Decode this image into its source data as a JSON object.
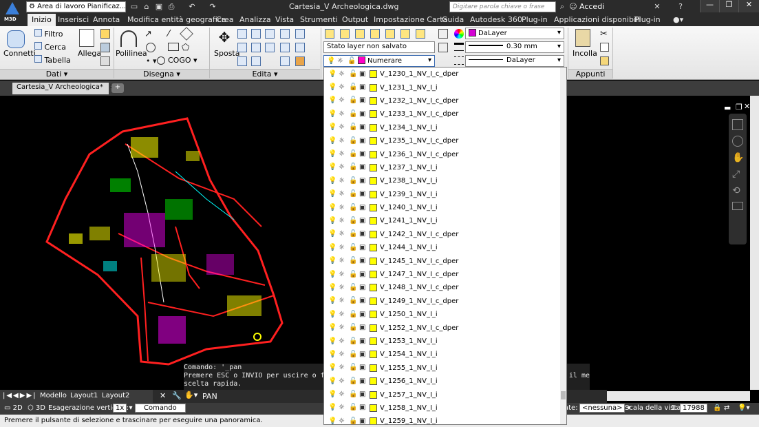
{
  "app": {
    "logo_tag": "M3D",
    "title": "Cartesia_V Archeologica.dwg"
  },
  "workspace": {
    "label": "Area di lavoro Pianificaz..."
  },
  "search": {
    "placeholder": "Digitare parola chiave o frase"
  },
  "account": {
    "signin": "Accedi"
  },
  "menu_tabs": [
    "Inizio",
    "Inserisci",
    "Annota",
    "Modifica entità geografica",
    "Crea",
    "Analizza",
    "Vista",
    "Strumenti",
    "Output",
    "Impostazione Carta",
    "Guida",
    "Autodesk 360",
    "Plug-in",
    "Applicazioni disponibili",
    "Plug-in"
  ],
  "ribbon": {
    "dati": {
      "connetti": "Connetti",
      "filtro": "Filtro",
      "cerca": "Cerca",
      "tabella": "Tabella",
      "allega": "Allega",
      "panel": "Dati"
    },
    "disegna": {
      "polilinea": "Polilinea",
      "cogo": "COGO",
      "panel": "Disegna"
    },
    "edita": {
      "sposta": "Sposta",
      "panel": "Edita"
    },
    "layers": {
      "stato": "Stato layer non salvato",
      "current": "Numerare",
      "current_color": "#ff00c8"
    },
    "properties": {
      "color": "DaLayer",
      "color_swatch": "#d400d4",
      "lineweight": "0.30 mm",
      "linetype": "DaLayer"
    },
    "appunti": {
      "incolla": "Incolla",
      "panel": "Appunti"
    }
  },
  "file_tab": {
    "label": "Cartesia_V Archeologica*"
  },
  "layer_list": [
    "V_1230_1_NV_I_c_dper",
    "V_1231_1_NV_I_i",
    "V_1232_1_NV_I_c_dper",
    "V_1233_1_NV_I_c_dper",
    "V_1234_1_NV_I_i",
    "V_1235_1_NV_I_c_dper",
    "V_1236_1_NV_I_c_dper",
    "V_1237_1_NV_I_i",
    "V_1238_1_NV_I_i",
    "V_1239_1_NV_I_i",
    "V_1240_1_NV_I_i",
    "V_1241_1_NV_I_i",
    "V_1242_1_NV_I_c_dper",
    "V_1244_1_NV_I_i",
    "V_1245_1_NV_I_c_dper",
    "V_1247_1_NV_I_c_dper",
    "V_1248_1_NV_I_c_dper",
    "V_1249_1_NV_I_c_dper",
    "V_1250_1_NV_I_i",
    "V_1252_1_NV_I_c_dper",
    "V_1253_1_NV_I_i",
    "V_1254_1_NV_I_i",
    "V_1255_1_NV_I_i",
    "V_1256_1_NV_I_i",
    "V_1257_1_NV_I_i",
    "V_1258_1_NV_I_i",
    "V_1259_1_NV_I_i"
  ],
  "layer_color": "#ffff00",
  "command": {
    "log1": "Comando: '_pan",
    "log2": "Premere ESC o INVIO per uscire o fare clic con il pulsante destro del mouse per visualizzare il menu di",
    "log3": "scelta rapida.",
    "current": "PAN",
    "label": "Comando"
  },
  "layout_tabs": [
    "Modello",
    "Layout1",
    "Layout2"
  ],
  "status": {
    "view2d": "2D",
    "view3d": "3D",
    "exag_label": "Esagerazione verticale:",
    "exag_value": "1x",
    "dati": "ate:",
    "dati_value": "<nessuna>",
    "scale_label": "Scala della vista",
    "scale_value": "1:",
    "scale_num": "17988"
  },
  "prompt": "Premere il pulsante di selezione e trascinare per eseguire una panoramica."
}
